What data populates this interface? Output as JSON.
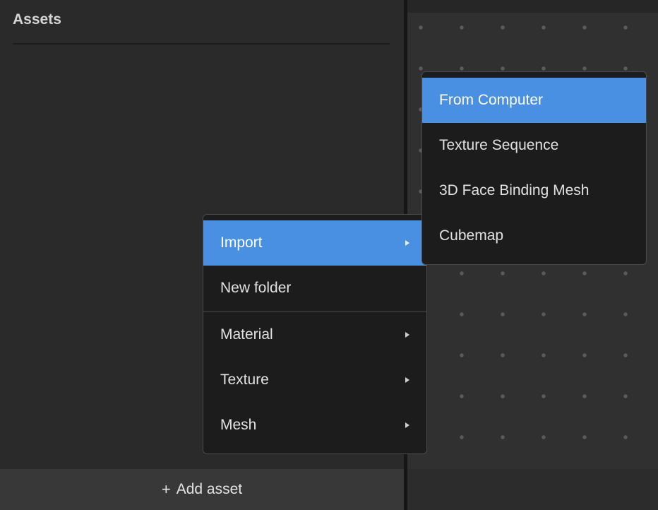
{
  "assets_panel": {
    "title": "Assets",
    "add_asset": {
      "icon": "+",
      "label": "Add asset"
    }
  },
  "context_menu": {
    "items": [
      {
        "label": "Import",
        "has_submenu": true,
        "active": true
      },
      {
        "label": "New folder",
        "has_submenu": false
      },
      {
        "label": "Material",
        "has_submenu": true
      },
      {
        "label": "Texture",
        "has_submenu": true
      },
      {
        "label": "Mesh",
        "has_submenu": true
      }
    ]
  },
  "import_submenu": {
    "items": [
      {
        "label": "From Computer",
        "active": true
      },
      {
        "label": "Texture Sequence"
      },
      {
        "label": "3D Face Binding Mesh"
      },
      {
        "label": "Cubemap"
      }
    ]
  },
  "colors": {
    "accent": "#4a90e2",
    "panel_bg": "#2a2a2a",
    "menu_bg": "#1c1c1d",
    "viewport_bg": "#303030"
  }
}
